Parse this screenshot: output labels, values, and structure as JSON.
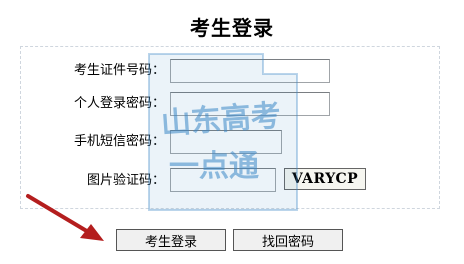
{
  "page": {
    "title": "考生登录"
  },
  "form": {
    "fields": [
      {
        "label": "考生证件号码：",
        "value": ""
      },
      {
        "label": "个人登录密码：",
        "value": ""
      },
      {
        "label": "手机短信密码：",
        "value": ""
      },
      {
        "label": "图片验证码：",
        "value": ""
      }
    ],
    "captcha_text": "VARYCP"
  },
  "buttons": {
    "login": "考生登录",
    "recover": "找回密码"
  },
  "watermark": {
    "line1": "山东高考",
    "line2": "一点通"
  },
  "colors": {
    "watermark": "#3b86c6",
    "arrow": "#b41e1e",
    "panel_border": "#cfd6de"
  }
}
